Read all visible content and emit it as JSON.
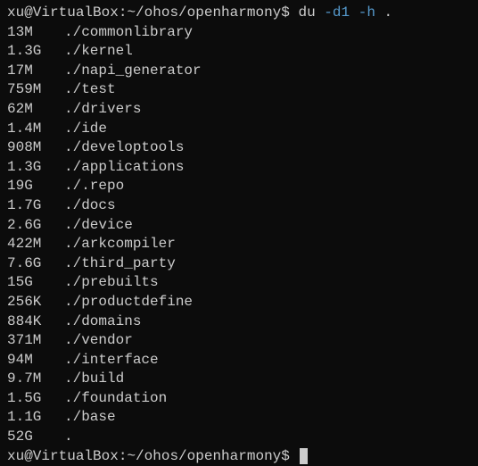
{
  "prompt": {
    "user_host": "xu@VirtualBox",
    "separator": ":",
    "path": "~/ohos/openharmony",
    "symbol": "$",
    "command": "du",
    "flag1": "-d1",
    "flag2": "-h",
    "target": "."
  },
  "output": [
    {
      "size": "13M",
      "path": "./commonlibrary"
    },
    {
      "size": "1.3G",
      "path": "./kernel"
    },
    {
      "size": "17M",
      "path": "./napi_generator"
    },
    {
      "size": "759M",
      "path": "./test"
    },
    {
      "size": "62M",
      "path": "./drivers"
    },
    {
      "size": "1.4M",
      "path": "./ide"
    },
    {
      "size": "908M",
      "path": "./developtools"
    },
    {
      "size": "1.3G",
      "path": "./applications"
    },
    {
      "size": "19G",
      "path": "./.repo"
    },
    {
      "size": "1.7G",
      "path": "./docs"
    },
    {
      "size": "2.6G",
      "path": "./device"
    },
    {
      "size": "422M",
      "path": "./arkcompiler"
    },
    {
      "size": "7.6G",
      "path": "./third_party"
    },
    {
      "size": "15G",
      "path": "./prebuilts"
    },
    {
      "size": "256K",
      "path": "./productdefine"
    },
    {
      "size": "884K",
      "path": "./domains"
    },
    {
      "size": "371M",
      "path": "./vendor"
    },
    {
      "size": "94M",
      "path": "./interface"
    },
    {
      "size": "9.7M",
      "path": "./build"
    },
    {
      "size": "1.5G",
      "path": "./foundation"
    },
    {
      "size": "1.1G",
      "path": "./base"
    },
    {
      "size": "52G",
      "path": "."
    }
  ]
}
